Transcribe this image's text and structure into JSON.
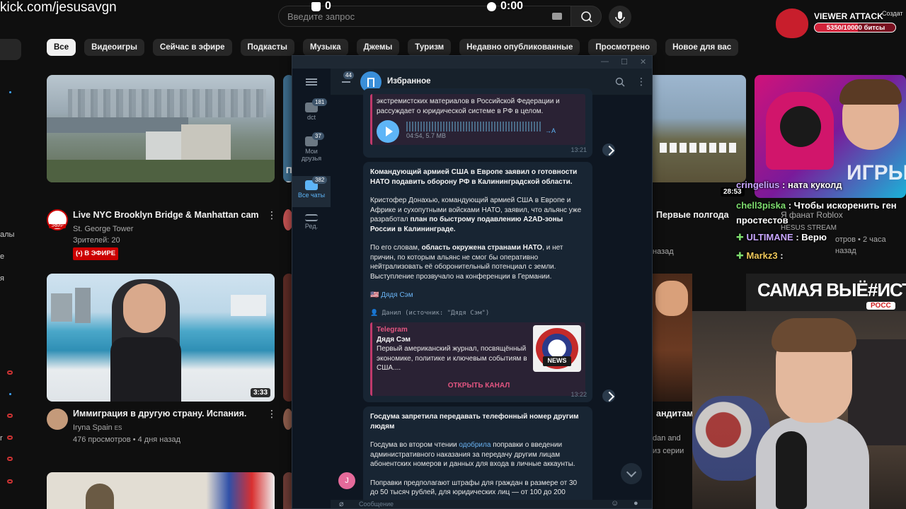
{
  "stream": {
    "kick_url": "kick.com/jesusavgn",
    "counter_value": "0",
    "timer_value": "0:00",
    "viewer_attack": {
      "title": "VIEWER ATTACK",
      "progress_text": "5350/10000 битсы",
      "progress_fraction": 0.535,
      "create_label": "Создат"
    },
    "chat": [
      {
        "user": "cringelius",
        "text": " : ната куколд",
        "color": "#c9a7ff"
      },
      {
        "user": "chell3piska",
        "text": " : Чтобы искоренить ген простестов",
        "color": "#7ddc6e"
      },
      {
        "user": "ULTIMANE",
        "text": " : Верю",
        "color": "#c9a7ff"
      },
      {
        "user": "Markz3",
        "text": " :",
        "color": "#f0c95a"
      }
    ]
  },
  "youtube": {
    "search_placeholder": "Введите запрос",
    "chips": [
      "Все",
      "Видеоигры",
      "Сейчас в эфире",
      "Подкасты",
      "Музыка",
      "Джемы",
      "Туризм",
      "Недавно опубликованные",
      "Просмотрено",
      "Новое для вас"
    ],
    "left_labels": [
      "алы",
      "е",
      "я",
      "r"
    ],
    "videos": {
      "nyc": {
        "title": "Live NYC Brooklyn Bridge & Manhattan cam",
        "channel": "St. George Tower",
        "viewers": "Зрителей: 20",
        "live": "(•) В ЭФИРЕ",
        "avatar_label": "ЭФИР"
      },
      "spain": {
        "title": "Иммиграция в другую страну. Испания.",
        "channel": "Iryna Spain",
        "channel_suffix": "ES",
        "meta": "476 просмотров • 4 дня назад",
        "duration": "3:33"
      },
      "right_top": {
        "title": "Первые полгода",
        "meta": "назад"
      },
      "roblox": {
        "duration": "28:53",
        "title": "Я фанат Roblox",
        "channel": "HESUS STREAM",
        "meta": "отров • 2 часа назад",
        "thumb_text": "ИГРЫ"
      },
      "right_mid": {
        "title": "андитам н",
        "meta": "dan and",
        "meta2": "из серии"
      },
      "samaya": {
        "thumb_text": "САМАЯ ВЫЁ#ИСТА",
        "sub_text": "РОСС"
      },
      "cut_left": {
        "t1": "П",
        "t2": "Т"
      }
    }
  },
  "telegram": {
    "chat_title": "Избранное",
    "back_badge": "44",
    "folders": [
      {
        "label": "dct",
        "badge": "181"
      },
      {
        "label": "Мои друзья",
        "badge": "37"
      },
      {
        "label": "Все чаты",
        "badge": "382"
      },
      {
        "label": "Ред.",
        "badge": ""
      }
    ],
    "msg1": {
      "text": "экстремистских материалов в Российской Федерации и рассуждает о юридической системе в РФ в целом.",
      "audio_meta": "04:54, 5.7 MB",
      "transcribe": "→A",
      "time": "13:21"
    },
    "msg2": {
      "headline": "Командующий армией США в Европе заявил о готовности НАТО подавить оборону РФ в Калининградской области.",
      "p1a": "Кристофер Донахью, командующий армией США в Европе и Африке и сухопутными войсками НАТО, заявил, что альянс уже разработал ",
      "p1b": "план по быстрому подавлению A2AD-зоны России в Калининграде.",
      "p2a": "По его словам, ",
      "p2b": "область окружена странами НАТО",
      "p2c": ", и нет причин, по которым альянс не смог бы оперативно нейтрализовать её оборонительный потенциал с земли. Выступление прозвучало на конференции в Германии.",
      "signature": "🇺🇸 Дядя Сэм",
      "forwarded": "👤 Данил (источник: \"Дядя Сэм\")",
      "preview_source": "Telegram",
      "preview_name": "Дядя Сэм",
      "preview_desc": "Первый американский журнал, посвящённый экономике, политике и ключевым событиям в США....",
      "news_label": "NEWS",
      "open_channel": "ОТКРЫТЬ КАНАЛ",
      "time": "13:22"
    },
    "msg3": {
      "headline": "Госдума запретила передавать телефонный номер другим людям",
      "p1a": "Госдума во втором чтении ",
      "p1link": "одобрила",
      "p1b": " поправки о введении административного наказания за передачу другим лицам абонентских номеров и данных для входа в личные аккаунты.",
      "p2": "Поправки предполагают штрафы для граждан в размере от 30 до 50 тысяч рублей, для юридических лиц — от 100 до 200 тысяч."
    },
    "input_placeholder": "Сообщение",
    "avatar_letter": "J"
  }
}
